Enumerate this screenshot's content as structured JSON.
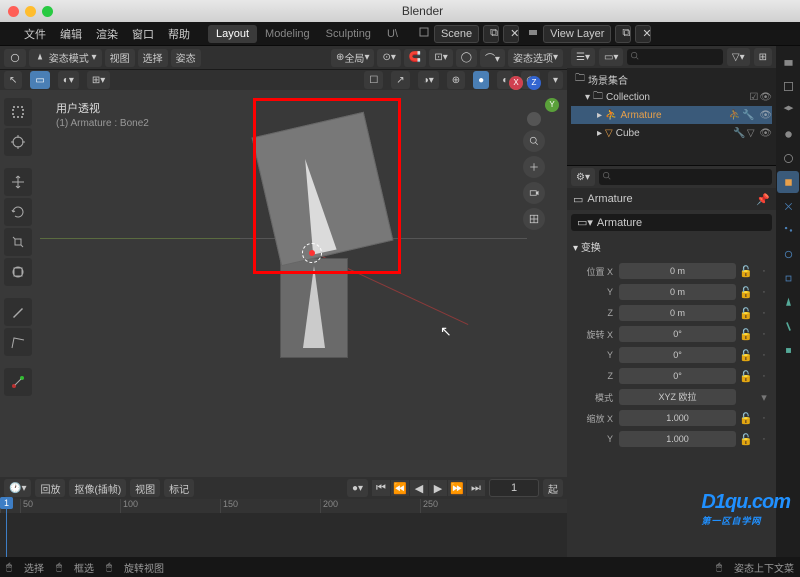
{
  "title": "Blender",
  "menu": {
    "file": "文件",
    "edit": "编辑",
    "render": "渲染",
    "window": "窗口",
    "help": "帮助"
  },
  "workspace": {
    "layout": "Layout",
    "modeling": "Modeling",
    "sculpting": "Sculpting",
    "uv": "U\\"
  },
  "scene": {
    "label": "Scene",
    "layer": "View Layer"
  },
  "vp_header": {
    "mode": "姿态模式",
    "view": "视图",
    "select": "选择",
    "pose": "姿态",
    "global": "全局",
    "options": "姿态选项"
  },
  "vp_info": {
    "persp": "用户透视",
    "obj": "(1) Armature : Bone2"
  },
  "outliner": {
    "scene_coll": "场景集合",
    "collection": "Collection",
    "armature": "Armature",
    "cube": "Cube"
  },
  "props": {
    "name": "Armature",
    "breadcrumb": "Armature",
    "transform": "变换",
    "locx": "位置 X",
    "y": "Y",
    "z": "Z",
    "rotx": "旋转 X",
    "mode": "模式",
    "mode_val": "XYZ 欧拉",
    "scalex": "缩放 X",
    "zero_m": "0 m",
    "zero_deg": "0°",
    "one": "1.000"
  },
  "timeline": {
    "playback": "回放",
    "keying": "抠像(插帧)",
    "view": "视图",
    "marker": "标记",
    "frame": "1",
    "start": "起",
    "ticks": [
      "1",
      "50",
      "100",
      "150",
      "200",
      "250"
    ]
  },
  "status": {
    "select": "选择",
    "box": "框选",
    "rotate": "旋转视图",
    "ctx": "姿态上下文菜"
  },
  "watermark": {
    "main": "D1qu.com",
    "sub": "第一区自学网"
  }
}
